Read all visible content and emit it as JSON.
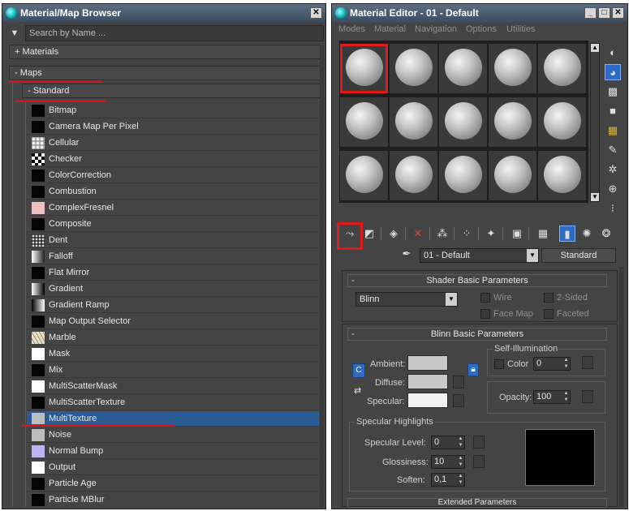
{
  "browser": {
    "title": "Material/Map Browser",
    "search_placeholder": "Search by Name ...",
    "group_materials": "+ Materials",
    "group_maps": "- Maps",
    "group_standard": "- Standard",
    "items": [
      {
        "label": "Bitmap",
        "swatch": "#050505"
      },
      {
        "label": "Camera Map Per Pixel",
        "swatch": "#050505"
      },
      {
        "label": "Cellular",
        "swatch": "cellular"
      },
      {
        "label": "Checker",
        "swatch": "checker"
      },
      {
        "label": "ColorCorrection",
        "swatch": "#050505"
      },
      {
        "label": "Combustion",
        "swatch": "#050505"
      },
      {
        "label": "ComplexFresnel",
        "swatch": "#f2c0bc"
      },
      {
        "label": "Composite",
        "swatch": "#050505"
      },
      {
        "label": "Dent",
        "swatch": "dent"
      },
      {
        "label": "Falloff",
        "swatch": "falloff"
      },
      {
        "label": "Flat Mirror",
        "swatch": "#050505"
      },
      {
        "label": "Gradient",
        "swatch": "gradient"
      },
      {
        "label": "Gradient Ramp",
        "swatch": "ramp"
      },
      {
        "label": "Map Output Selector",
        "swatch": "#050505"
      },
      {
        "label": "Marble",
        "swatch": "marble"
      },
      {
        "label": "Mask",
        "swatch": "#ffffff"
      },
      {
        "label": "Mix",
        "swatch": "#050505"
      },
      {
        "label": "MultiScatterMask",
        "swatch": "#ffffff"
      },
      {
        "label": "MultiScatterTexture",
        "swatch": "#050505"
      },
      {
        "label": "MultiTexture",
        "swatch": "#bdbdbd",
        "selected": true
      },
      {
        "label": "Noise",
        "swatch": "#bdbdbd"
      },
      {
        "label": "Normal Bump",
        "swatch": "#b9b5f2"
      },
      {
        "label": "Output",
        "swatch": "#ffffff"
      },
      {
        "label": "Particle Age",
        "swatch": "#050505"
      },
      {
        "label": "Particle MBlur",
        "swatch": "#050505"
      }
    ]
  },
  "editor": {
    "title": "Material Editor - 01 - Default",
    "menu": [
      "Modes",
      "Material",
      "Navigation",
      "Options",
      "Utilities"
    ],
    "material_name": "01 - Default",
    "material_type": "Standard",
    "shader_rollout": {
      "title": "Shader Basic Parameters",
      "shader": "Blinn",
      "wire": "Wire",
      "two_sided": "2-Sided",
      "face_map": "Face Map",
      "faceted": "Faceted"
    },
    "blinn_rollout": {
      "title": "Blinn Basic Parameters",
      "self_illum": "Self-Illumination",
      "color_label": "Color",
      "color_value": "0",
      "ambient": "Ambient:",
      "diffuse": "Diffuse:",
      "specular": "Specular:",
      "opacity_label": "Opacity:",
      "opacity_value": "100",
      "ambient_color": "#c8c8c8",
      "diffuse_color": "#c8c8c8",
      "specular_color": "#f2f2f2"
    },
    "specular_highlights": {
      "title": "Specular Highlights",
      "level_label": "Specular Level:",
      "level_value": "0",
      "gloss_label": "Glossiness:",
      "gloss_value": "10",
      "soften_label": "Soften:",
      "soften_value": "0,1"
    },
    "next_rollout": "Extended Parameters",
    "icons": {
      "side": [
        "sample-type-icon",
        "backlight-icon",
        "background-icon",
        "uv-tiling-icon",
        "video-color-check-icon",
        "make-preview-icon",
        "options-icon",
        "select-by-material-icon",
        "material-map-navigator-icon"
      ],
      "toolbar": [
        "get-material-icon",
        "put-to-scene-icon",
        "assign-to-selection-icon",
        "reset-map-icon",
        "make-unique-icon",
        "put-to-library-icon",
        "material-id-channel-icon",
        "show-shaded-in-viewport-icon",
        "show-end-result-icon",
        "go-to-parent-icon",
        "go-forward-to-sibling-icon"
      ]
    }
  }
}
